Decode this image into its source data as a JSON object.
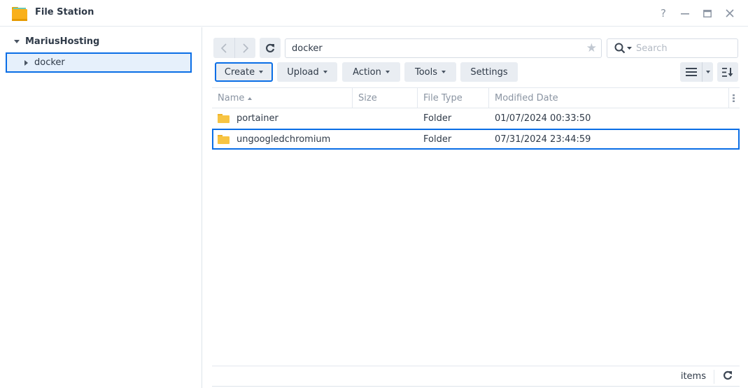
{
  "window": {
    "title": "File Station",
    "controls": {
      "help": "?",
      "minimize": "minimize",
      "maximize": "maximize",
      "close": "close"
    }
  },
  "sidebar": {
    "root": {
      "label": "MariusHosting",
      "expanded": true
    },
    "items": [
      {
        "label": "docker",
        "selected": true,
        "expanded": false
      }
    ]
  },
  "toolbar": {
    "path_value": "docker",
    "search_placeholder": "Search",
    "buttons": {
      "create": "Create",
      "upload": "Upload",
      "action": "Action",
      "tools": "Tools",
      "settings": "Settings"
    }
  },
  "grid": {
    "columns": {
      "name": "Name",
      "size": "Size",
      "type": "File Type",
      "date": "Modified Date"
    },
    "sort": {
      "column": "name",
      "direction": "ascending"
    },
    "rows": [
      {
        "name": "portainer",
        "size": "",
        "type": "Folder",
        "date": "01/07/2024 00:33:50",
        "selected": false
      },
      {
        "name": "ungoogledchromium",
        "size": "",
        "type": "Folder",
        "date": "07/31/2024 23:44:59",
        "selected": true
      }
    ]
  },
  "footer": {
    "items_label": "items"
  },
  "colors": {
    "accent": "#0a6ee6",
    "selection_bg": "#e6f0fb",
    "button_bg": "#e9edf2",
    "folder": "#f7c443"
  }
}
